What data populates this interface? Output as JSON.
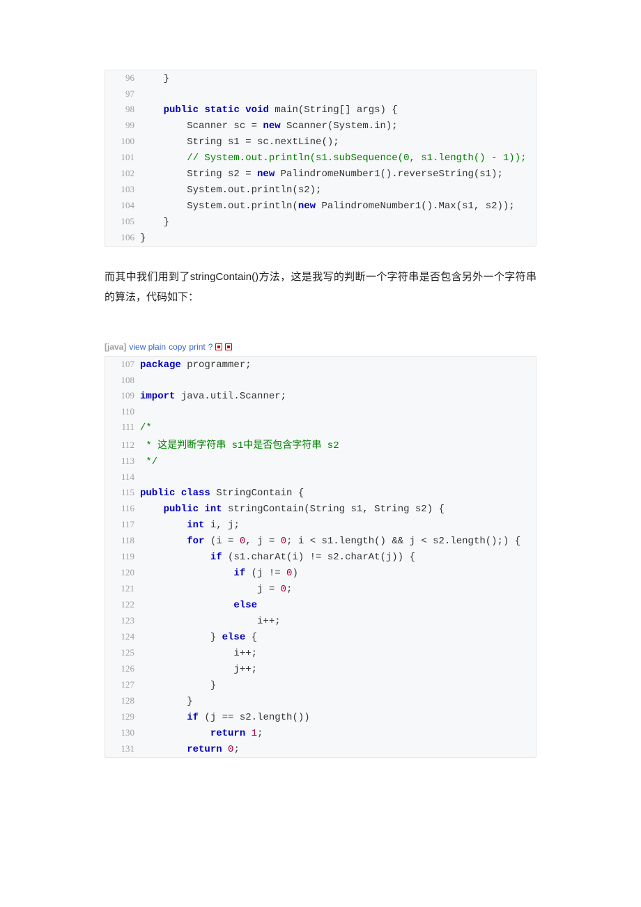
{
  "block1": {
    "lines": [
      {
        "n": 96,
        "segs": [
          {
            "t": "    }"
          }
        ]
      },
      {
        "n": 97,
        "segs": [
          {
            "t": ""
          }
        ]
      },
      {
        "n": 98,
        "segs": [
          {
            "t": "    "
          },
          {
            "t": "public",
            "c": "kw"
          },
          {
            "t": " "
          },
          {
            "t": "static",
            "c": "kw"
          },
          {
            "t": " "
          },
          {
            "t": "void",
            "c": "kw"
          },
          {
            "t": " main(String[] args) {"
          }
        ]
      },
      {
        "n": 99,
        "segs": [
          {
            "t": "        Scanner sc = "
          },
          {
            "t": "new",
            "c": "kw"
          },
          {
            "t": " Scanner(System.in);"
          }
        ]
      },
      {
        "n": 100,
        "segs": [
          {
            "t": "        String s1 = sc.nextLine();"
          }
        ]
      },
      {
        "n": 101,
        "segs": [
          {
            "t": "        "
          },
          {
            "t": "// System.out.println(s1.subSequence(0, s1.length() - 1));",
            "c": "cmt"
          }
        ]
      },
      {
        "n": 102,
        "segs": [
          {
            "t": "        String s2 = "
          },
          {
            "t": "new",
            "c": "kw"
          },
          {
            "t": " PalindromeNumber1().reverseString(s1);"
          }
        ]
      },
      {
        "n": 103,
        "segs": [
          {
            "t": "        System.out.println(s2);"
          }
        ]
      },
      {
        "n": 104,
        "segs": [
          {
            "t": "        System.out.println("
          },
          {
            "t": "new",
            "c": "kw"
          },
          {
            "t": " PalindromeNumber1().Max(s1, s2));"
          }
        ]
      },
      {
        "n": 105,
        "segs": [
          {
            "t": "    }"
          }
        ]
      },
      {
        "n": 106,
        "segs": [
          {
            "t": "}"
          }
        ]
      }
    ]
  },
  "prose1": "而其中我们用到了stringContain()方法，这是我写的判断一个字符串是否包含另外一个字符串的算法，代码如下：",
  "toolbar": {
    "lang": "[java]",
    "links": [
      "view plain",
      "copy",
      "print",
      "?"
    ]
  },
  "block2": {
    "lines": [
      {
        "n": 107,
        "segs": [
          {
            "t": "package",
            "c": "kw"
          },
          {
            "t": " programmer;"
          }
        ]
      },
      {
        "n": 108,
        "segs": [
          {
            "t": ""
          }
        ]
      },
      {
        "n": 109,
        "segs": [
          {
            "t": "import",
            "c": "kw"
          },
          {
            "t": " java.util.Scanner;"
          }
        ]
      },
      {
        "n": 110,
        "segs": [
          {
            "t": ""
          }
        ]
      },
      {
        "n": 111,
        "segs": [
          {
            "t": "/*",
            "c": "cmt"
          }
        ]
      },
      {
        "n": 112,
        "segs": [
          {
            "t": " * 这是判断字符串 s1中是否包含字符串 s2",
            "c": "cmt"
          }
        ]
      },
      {
        "n": 113,
        "segs": [
          {
            "t": " */",
            "c": "cmt"
          }
        ]
      },
      {
        "n": 114,
        "segs": [
          {
            "t": ""
          }
        ]
      },
      {
        "n": 115,
        "segs": [
          {
            "t": "public",
            "c": "kw"
          },
          {
            "t": " "
          },
          {
            "t": "class",
            "c": "kw"
          },
          {
            "t": " StringContain {"
          }
        ]
      },
      {
        "n": 116,
        "segs": [
          {
            "t": "    "
          },
          {
            "t": "public",
            "c": "kw"
          },
          {
            "t": " "
          },
          {
            "t": "int",
            "c": "kw"
          },
          {
            "t": " stringContain(String s1, String s2) {"
          }
        ]
      },
      {
        "n": 117,
        "segs": [
          {
            "t": "        "
          },
          {
            "t": "int",
            "c": "kw"
          },
          {
            "t": " i, j;"
          }
        ]
      },
      {
        "n": 118,
        "segs": [
          {
            "t": "        "
          },
          {
            "t": "for",
            "c": "kw"
          },
          {
            "t": " (i = "
          },
          {
            "t": "0",
            "c": "num"
          },
          {
            "t": ", j = "
          },
          {
            "t": "0",
            "c": "num"
          },
          {
            "t": "; i < s1.length() && j < s2.length();) {"
          }
        ]
      },
      {
        "n": 119,
        "segs": [
          {
            "t": "            "
          },
          {
            "t": "if",
            "c": "kw"
          },
          {
            "t": " (s1.charAt(i) != s2.charAt(j)) {"
          }
        ]
      },
      {
        "n": 120,
        "segs": [
          {
            "t": "                "
          },
          {
            "t": "if",
            "c": "kw"
          },
          {
            "t": " (j != "
          },
          {
            "t": "0",
            "c": "num"
          },
          {
            "t": ")"
          }
        ]
      },
      {
        "n": 121,
        "segs": [
          {
            "t": "                    j = "
          },
          {
            "t": "0",
            "c": "num"
          },
          {
            "t": ";"
          }
        ]
      },
      {
        "n": 122,
        "segs": [
          {
            "t": "                "
          },
          {
            "t": "else",
            "c": "kw"
          }
        ]
      },
      {
        "n": 123,
        "segs": [
          {
            "t": "                    i++;"
          }
        ]
      },
      {
        "n": 124,
        "segs": [
          {
            "t": "            } "
          },
          {
            "t": "else",
            "c": "kw"
          },
          {
            "t": " {"
          }
        ]
      },
      {
        "n": 125,
        "segs": [
          {
            "t": "                i++;"
          }
        ]
      },
      {
        "n": 126,
        "segs": [
          {
            "t": "                j++;"
          }
        ]
      },
      {
        "n": 127,
        "segs": [
          {
            "t": "            }"
          }
        ]
      },
      {
        "n": 128,
        "segs": [
          {
            "t": "        }"
          }
        ]
      },
      {
        "n": 129,
        "segs": [
          {
            "t": "        "
          },
          {
            "t": "if",
            "c": "kw"
          },
          {
            "t": " (j == s2.length())"
          }
        ]
      },
      {
        "n": 130,
        "segs": [
          {
            "t": "            "
          },
          {
            "t": "return",
            "c": "kw"
          },
          {
            "t": " "
          },
          {
            "t": "1",
            "c": "num"
          },
          {
            "t": ";"
          }
        ]
      },
      {
        "n": 131,
        "segs": [
          {
            "t": "        "
          },
          {
            "t": "return",
            "c": "kw"
          },
          {
            "t": " "
          },
          {
            "t": "0",
            "c": "num"
          },
          {
            "t": ";"
          }
        ]
      }
    ]
  }
}
